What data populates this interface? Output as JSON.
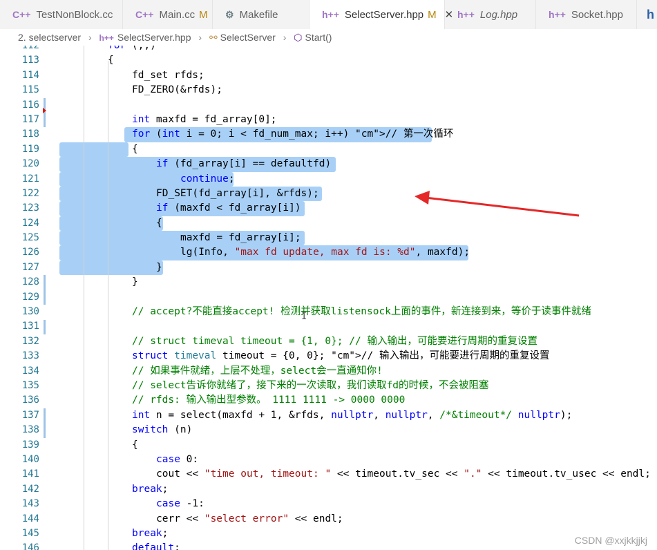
{
  "tabs": [
    {
      "label": "TestNonBlock.cc",
      "icon": "cpp-file-icon",
      "icon_text": "C++",
      "modified": "",
      "active": false,
      "italic": false
    },
    {
      "label": "Main.cc",
      "icon": "cpp-file-icon",
      "icon_text": "C++",
      "modified": "M",
      "active": false,
      "italic": false
    },
    {
      "label": "Makefile",
      "icon": "makefile-icon",
      "icon_text": "⚙",
      "modified": "",
      "active": false,
      "italic": false
    },
    {
      "label": "SelectServer.hpp",
      "icon": "hpp-file-icon",
      "icon_text": "h++",
      "modified": "M",
      "active": true,
      "italic": false,
      "close": "✕"
    },
    {
      "label": "Log.hpp",
      "icon": "hpp-file-icon",
      "icon_text": "h++",
      "modified": "",
      "active": false,
      "italic": true
    },
    {
      "label": "Socket.hpp",
      "icon": "hpp-file-icon",
      "icon_text": "h++",
      "modified": "",
      "active": false,
      "italic": false
    },
    {
      "label": "",
      "icon": "hpp-file-icon",
      "icon_text": "h",
      "modified": "",
      "active": false,
      "italic": false
    }
  ],
  "breadcrumb": {
    "folder": "2. selectserver",
    "file": "SelectServer.hpp",
    "file_icon_text": "h++",
    "class": "SelectServer",
    "method": "Start()"
  },
  "selection_color": "#a8d0f7",
  "code_lines": [
    {
      "n": "112",
      "t": "for (;;)"
    },
    {
      "n": "113",
      "t": "{"
    },
    {
      "n": "114",
      "t": "fd_set rfds;"
    },
    {
      "n": "115",
      "t": "FD_ZERO(&rfds);"
    },
    {
      "n": "116",
      "t": ""
    },
    {
      "n": "117",
      "t": "int maxfd = fd_array[0];"
    },
    {
      "n": "118",
      "t": "for (int i = 0; i < fd_num_max; i++) // 第一次循环"
    },
    {
      "n": "119",
      "t": "{"
    },
    {
      "n": "120",
      "t": "if (fd_array[i] == defaultfd)"
    },
    {
      "n": "121",
      "t": "continue;"
    },
    {
      "n": "122",
      "t": "FD_SET(fd_array[i], &rfds);"
    },
    {
      "n": "123",
      "t": "if (maxfd < fd_array[i])"
    },
    {
      "n": "124",
      "t": "{"
    },
    {
      "n": "125",
      "t": "maxfd = fd_array[i];"
    },
    {
      "n": "126",
      "t": "lg(Info, \"max fd update, max fd is: %d\", maxfd);"
    },
    {
      "n": "127",
      "t": "}"
    },
    {
      "n": "128",
      "t": "}"
    },
    {
      "n": "129",
      "t": ""
    },
    {
      "n": "130",
      "t": "// accept?不能直接accept! 检测并获取listensock上面的事件，新连接到来，等价于读事件就绪"
    },
    {
      "n": "131",
      "t": ""
    },
    {
      "n": "132",
      "t": "// struct timeval timeout = {1, 0}; // 输入输出，可能要进行周期的重复设置"
    },
    {
      "n": "133",
      "t": "struct timeval timeout = {0, 0}; // 输入输出，可能要进行周期的重复设置"
    },
    {
      "n": "134",
      "t": "// 如果事件就绪，上层不处理，select会一直通知你!"
    },
    {
      "n": "135",
      "t": "// select告诉你就绪了，接下来的一次读取，我们读取fd的时候，不会被阻塞"
    },
    {
      "n": "136",
      "t": "// rfds: 输入输出型参数。 1111 1111 -> 0000 0000"
    },
    {
      "n": "137",
      "t": "int n = select(maxfd + 1, &rfds, nullptr, nullptr, /*&timeout*/ nullptr);"
    },
    {
      "n": "138",
      "t": "switch (n)"
    },
    {
      "n": "139",
      "t": "{"
    },
    {
      "n": "140",
      "t": "case 0:"
    },
    {
      "n": "141",
      "t": "cout << \"time out, timeout: \" << timeout.tv_sec << \".\" << timeout.tv_usec << endl;"
    },
    {
      "n": "142",
      "t": "break;"
    },
    {
      "n": "143",
      "t": "case -1:"
    },
    {
      "n": "144",
      "t": "cerr << \"select error\" << endl;"
    },
    {
      "n": "145",
      "t": "break;"
    },
    {
      "n": "146",
      "t": "default:"
    }
  ],
  "watermark": "CSDN @xxjkkjjkj",
  "annotation_arrow_color": "#e52727"
}
